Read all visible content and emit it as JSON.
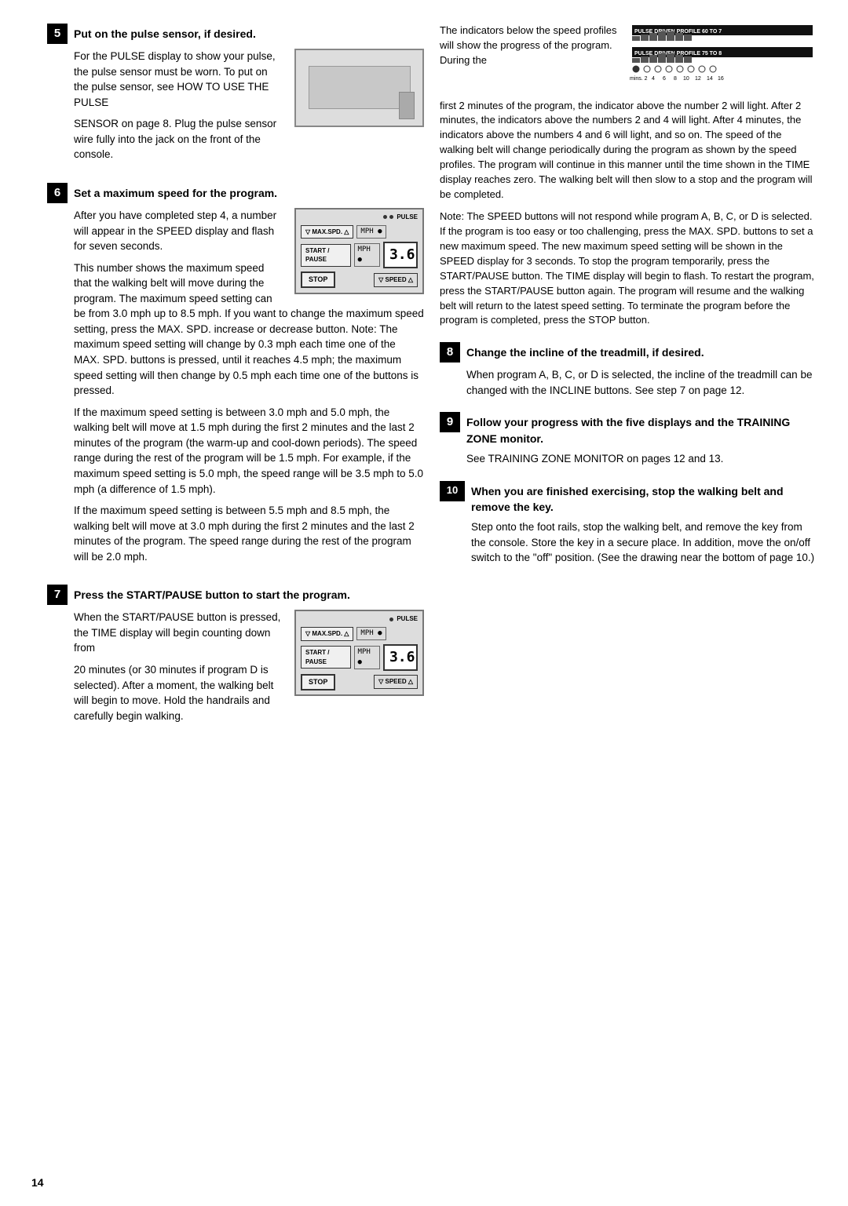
{
  "page": {
    "number": "14"
  },
  "steps": {
    "step5": {
      "number": "5",
      "title": "Put on the pulse sensor, if desired.",
      "body1": "For the PULSE display to show your pulse, the pulse sensor must be worn. To put on the pulse sensor, see HOW TO USE THE PULSE",
      "body2": "SENSOR on page 8. Plug the pulse sensor wire fully into the jack on the front of the console."
    },
    "step6": {
      "number": "6",
      "title": "Set a maximum speed for the program.",
      "body1": "After you have completed step 4, a number will appear in the SPEED display and flash for seven seconds.",
      "body2": "This number shows the maximum speed that the walking belt will move during the program. The maximum speed setting can be from 3.0 mph up to 8.5 mph. If you want to change the maximum speed setting, press the MAX. SPD. increase or decrease button. Note: The maximum speed setting will change by 0.3 mph each time one of the MAX. SPD. buttons is pressed, until it reaches 4.5 mph; the maximum speed setting will then change by 0.5 mph each time one of the buttons is pressed.",
      "body3": "If the maximum speed setting is between 3.0 mph and 5.0 mph, the walking belt will move at 1.5 mph during the first 2 minutes and the last 2 minutes of the program (the warm-up and cool-down periods). The speed range during the rest of the program will be 1.5 mph. For example, if the maximum speed setting is 5.0 mph, the speed range will be 3.5 mph to 5.0 mph (a difference of 1.5 mph).",
      "body4": "If the maximum speed setting is between 5.5 mph and 8.5 mph, the walking belt will move at 3.0 mph during the first 2 minutes and the last 2 minutes of the program. The speed range during the rest of the program will be 2.0 mph."
    },
    "step7": {
      "number": "7",
      "title": "Press the START/PAUSE button to start the program.",
      "body1": "When the START/PAUSE button is pressed, the TIME display will begin counting down from",
      "body2": "20 minutes (or 30 minutes if program D is selected). After a moment, the walking belt will begin to move. Hold the handrails and carefully begin walking."
    },
    "step8": {
      "number": "8",
      "title": "Change the incline of the treadmill, if desired.",
      "body1": "When program A, B, C, or D is selected, the incline of the treadmill can be changed with the INCLINE buttons. See step 7 on page 12."
    },
    "step9": {
      "number": "9",
      "title": "Follow your progress with the five displays and the TRAINING ZONE monitor.",
      "body1": "See TRAINING ZONE MONITOR on pages 12 and 13."
    },
    "step10": {
      "number": "10",
      "title": "When you are finished exercising, stop the walking belt and remove the key.",
      "body1": "Step onto the foot rails, stop the walking belt, and remove the key from the console. Store the key in a secure place. In addition, move the on/off switch to the \"off\" position. (See the drawing near the bottom of page 10.)"
    }
  },
  "right_col": {
    "indicators_text1": "The indicators below the speed profiles will show the progress of the program. During the",
    "profile1_label": "PULSE DRIVEN PROFILE 60 TO 7",
    "profile2_label": "PULSE DRIVEN PROFILE 75 TO 8",
    "mins_label": "mins.",
    "mins_values": [
      "2",
      "4",
      "6",
      "8",
      "10",
      "12",
      "14",
      "16"
    ],
    "body1": "first 2 minutes of the program, the indicator above the number 2 will light. After 2 minutes, the indicators above the numbers 2 and 4 will light. After 4 minutes, the indicators above the numbers 4 and 6 will light, and so on. The speed of the walking belt will change periodically during the program as shown by the speed profiles. The program will continue in this manner until the time shown in the TIME display reaches zero. The walking belt will then slow to a stop and the program will be completed.",
    "note": "Note: The SPEED buttons will not respond while program A, B, C, or D is selected. If the program is too easy or too challenging, press the MAX. SPD. buttons to set a new maximum speed. The new maximum speed setting will be shown in the SPEED display for 3 seconds. To stop the program temporarily, press the START/PAUSE button. The TIME display will begin to flash. To restart the program, press the START/PAUSE button again. The program will resume and the walking belt will return to the latest speed setting. To terminate the program before the program is completed, press the STOP button."
  },
  "console": {
    "display_value": "3.6",
    "pulse_label": "PULSE",
    "max_spd_label": "▽ MAX.SPD. △",
    "start_pause_label": "START / PAUSE",
    "stop_label": "STOP",
    "speed_label": "▽ SPEED △",
    "mph_label1": "MPH",
    "mph_label2": "MPH"
  }
}
